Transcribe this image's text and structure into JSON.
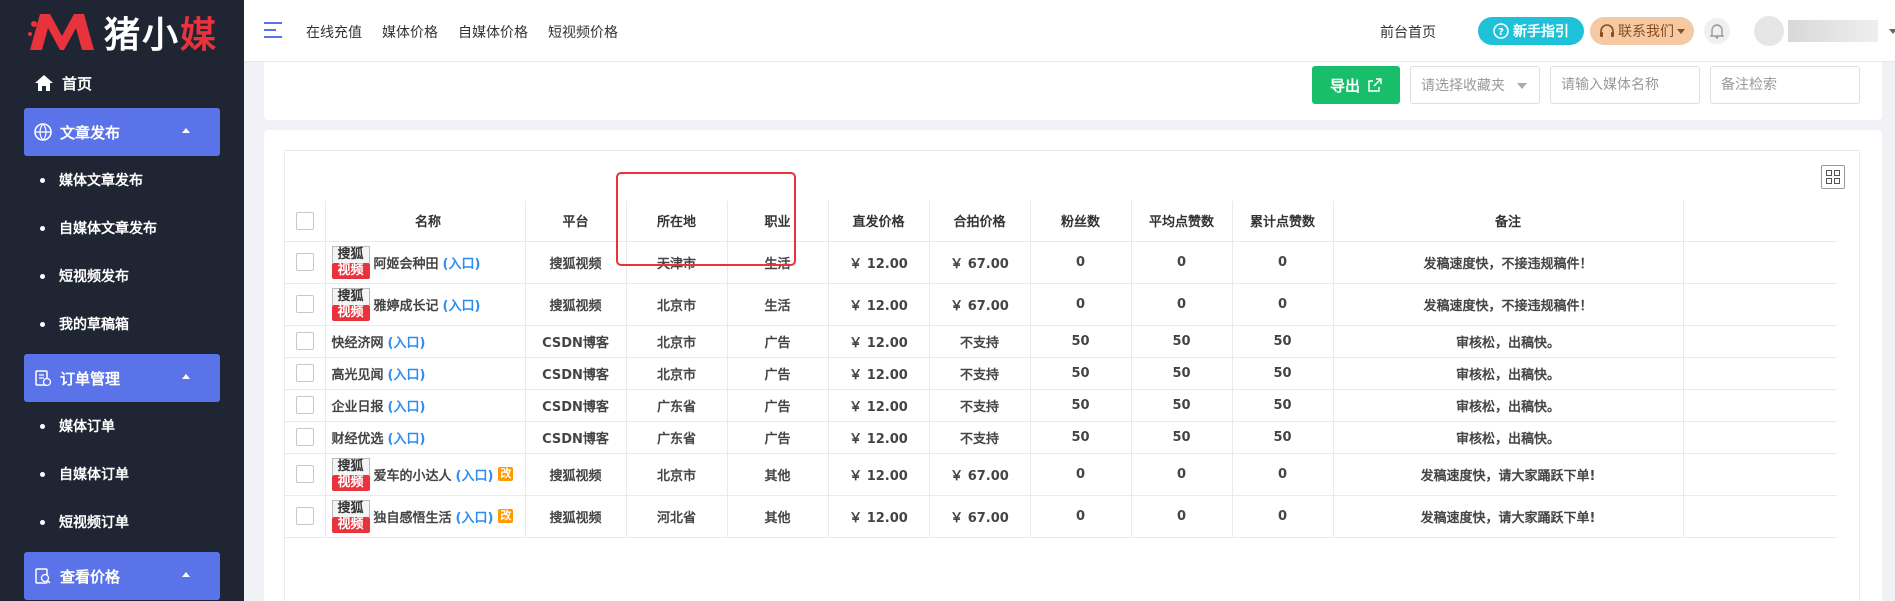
{
  "brand": {
    "logo_text_white": "猪小",
    "logo_text_red": "媒"
  },
  "sidebar": {
    "home": "首页",
    "groups": [
      {
        "label": "文章发布",
        "items": [
          "媒体文章发布",
          "自媒体文章发布",
          "短视频发布",
          "我的草稿箱"
        ]
      },
      {
        "label": "订单管理",
        "items": [
          "媒体订单",
          "自媒体订单",
          "短视频订单"
        ]
      },
      {
        "label": "查看价格",
        "items": []
      }
    ]
  },
  "header": {
    "links": [
      "在线充值",
      "媒体价格",
      "自媒体价格",
      "短视频价格"
    ],
    "front_home": "前台首页",
    "guide": "新手指引",
    "contact": "联系我们"
  },
  "filters": {
    "export": "导出",
    "favorite_placeholder": "请选择收藏夹",
    "name_placeholder": "请输入媒体名称",
    "note_placeholder": "备注检索"
  },
  "table": {
    "headers": [
      "名称",
      "平台",
      "所在地",
      "职业",
      "直发价格",
      "合拍价格",
      "粉丝数",
      "平均点赞数",
      "累计点赞数",
      "备注"
    ],
    "entry_label": "(入口)",
    "sohu_top": "搜狐",
    "sohu_bottom": "视频",
    "edit_tag": "改",
    "rows": [
      {
        "name": "阿姬会种田",
        "sohu": true,
        "edit": false,
        "platform": "搜狐视频",
        "location": "天津市",
        "job": "生活",
        "price1": "￥ 12.00",
        "price2": "￥ 67.00",
        "fans": "0",
        "avg": "0",
        "total": "0",
        "note": "发稿速度快，不接违规稿件！"
      },
      {
        "name": "雅婷成长记",
        "sohu": true,
        "edit": false,
        "platform": "搜狐视频",
        "location": "北京市",
        "job": "生活",
        "price1": "￥ 12.00",
        "price2": "￥ 67.00",
        "fans": "0",
        "avg": "0",
        "total": "0",
        "note": "发稿速度快，不接违规稿件！"
      },
      {
        "name": "快经济网",
        "sohu": false,
        "edit": false,
        "platform": "CSDN博客",
        "location": "北京市",
        "job": "广告",
        "price1": "￥ 12.00",
        "price2": "不支持",
        "fans": "50",
        "avg": "50",
        "total": "50",
        "note": "审核松，出稿快。"
      },
      {
        "name": "高光见闻",
        "sohu": false,
        "edit": false,
        "platform": "CSDN博客",
        "location": "北京市",
        "job": "广告",
        "price1": "￥ 12.00",
        "price2": "不支持",
        "fans": "50",
        "avg": "50",
        "total": "50",
        "note": "审核松，出稿快。"
      },
      {
        "name": "企业日报",
        "sohu": false,
        "edit": false,
        "platform": "CSDN博客",
        "location": "广东省",
        "job": "广告",
        "price1": "￥ 12.00",
        "price2": "不支持",
        "fans": "50",
        "avg": "50",
        "total": "50",
        "note": "审核松，出稿快。"
      },
      {
        "name": "财经优选",
        "sohu": false,
        "edit": false,
        "platform": "CSDN博客",
        "location": "广东省",
        "job": "广告",
        "price1": "￥ 12.00",
        "price2": "不支持",
        "fans": "50",
        "avg": "50",
        "total": "50",
        "note": "审核松，出稿快。"
      },
      {
        "name": "爱车的小达人",
        "sohu": true,
        "edit": true,
        "platform": "搜狐视频",
        "location": "北京市",
        "job": "其他",
        "price1": "￥ 12.00",
        "price2": "￥ 67.00",
        "fans": "0",
        "avg": "0",
        "total": "0",
        "note": "发稿速度快，请大家踊跃下单!"
      },
      {
        "name": "独自感悟生活",
        "sohu": true,
        "edit": true,
        "platform": "搜狐视频",
        "location": "河北省",
        "job": "其他",
        "price1": "￥ 12.00",
        "price2": "￥ 67.00",
        "fans": "0",
        "avg": "0",
        "total": "0",
        "note": "发稿速度快，请大家踊跃下单!"
      }
    ]
  }
}
